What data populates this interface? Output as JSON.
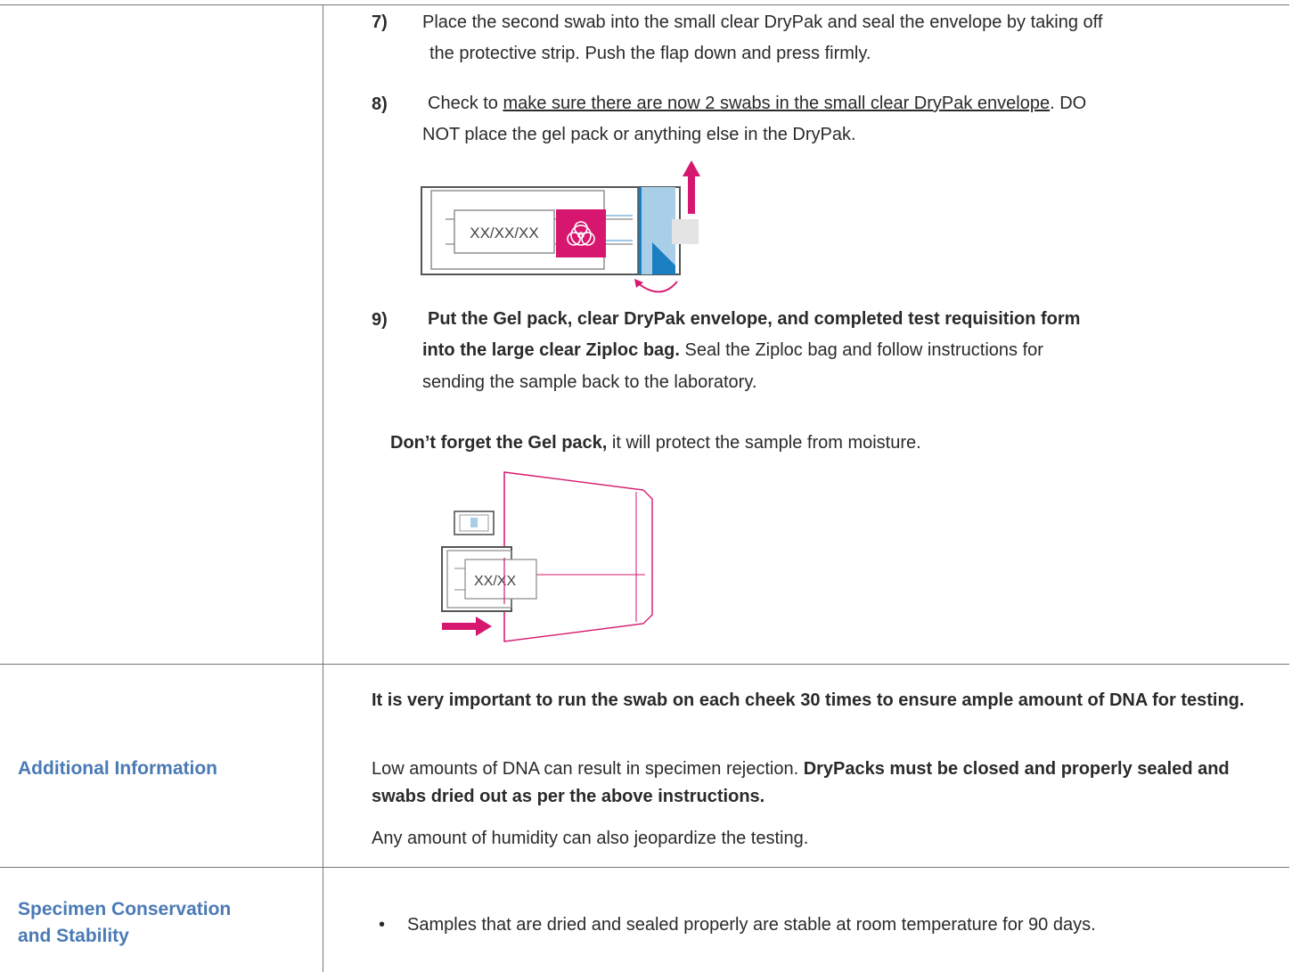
{
  "steps": {
    "s7": {
      "number": "7)",
      "line1": "Place the second swab into the small clear DryPak and seal the envelope by taking off",
      "line2": "the protective strip. Push the flap down and press firmly."
    },
    "s8": {
      "number": "8)",
      "pre": "Check to ",
      "underlined": "make sure there are now 2 swabs in the small clear DryPak envelope",
      "post": ". DO",
      "line2": "NOT place the gel pack or anything else in the DryPak."
    },
    "s9": {
      "number": "9)",
      "line1_bold": "Put the Gel pack, clear DryPak envelope, and completed test requisition form",
      "line2_bold": "into the large clear Ziploc bag.",
      "line2_rest": " Seal the Ziploc bag and follow instructions for",
      "line3": "sending the sample back to the laboratory."
    }
  },
  "reminder": {
    "bold": "Don’t forget the Gel pack,",
    "rest": " it will protect the sample from moisture."
  },
  "figures": {
    "drypak_label": "XX/XX/XX",
    "envelope_label": "XX/XX",
    "colors": {
      "magenta": "#d6166f",
      "blue": "#1a7fc0",
      "light_blue": "#a9cfe8",
      "outline": "#666666"
    }
  },
  "additional": {
    "label": "Additional Information",
    "p1": "It is very important to run the swab on each cheek 30 times to ensure ample amount of DNA for testing.",
    "p2_pre": "Low amounts of DNA can result in specimen rejection. ",
    "p2_bold": "DryPacks must be closed and properly sealed and swabs dried out as per the above instructions.",
    "p3": "Any amount of humidity can also jeopardize the testing."
  },
  "specimen": {
    "label_line1": "Specimen Conservation",
    "label_line2": "and Stability",
    "bullet": "•",
    "text": "Samples that are dried and sealed properly are stable at room temperature for 90 days."
  }
}
